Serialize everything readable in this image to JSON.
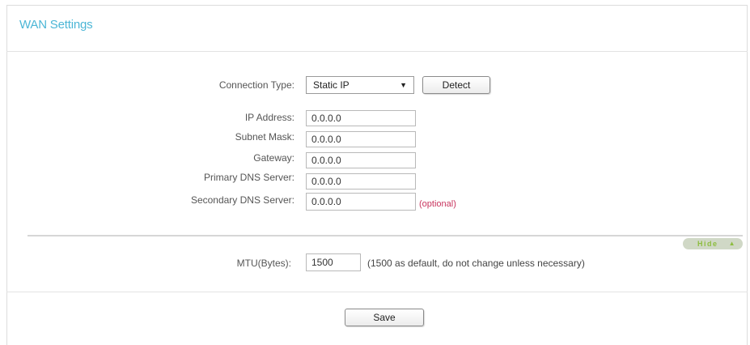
{
  "header": {
    "title": "WAN Settings"
  },
  "form": {
    "connection_type": {
      "label": "Connection Type:",
      "value": "Static IP",
      "detect_label": "Detect"
    },
    "ip_address": {
      "label": "IP Address:",
      "value": "0.0.0.0"
    },
    "subnet_mask": {
      "label": "Subnet Mask:",
      "value": "0.0.0.0"
    },
    "gateway": {
      "label": "Gateway:",
      "value": "0.0.0.0"
    },
    "primary_dns": {
      "label": "Primary DNS Server:",
      "value": "0.0.0.0"
    },
    "secondary_dns": {
      "label": "Secondary DNS Server:",
      "value": "0.0.0.0",
      "hint": "(optional)"
    }
  },
  "advanced": {
    "toggle_label": "Hide",
    "mtu": {
      "label": "MTU(Bytes):",
      "value": "1500",
      "note": "(1500 as default, do not change unless necessary)"
    }
  },
  "footer": {
    "save_label": "Save"
  },
  "colors": {
    "title": "#4cb6d6",
    "optional": "#c8345e",
    "hide_text": "#8dbd3f",
    "hide_bg": "#d0d8c6"
  }
}
